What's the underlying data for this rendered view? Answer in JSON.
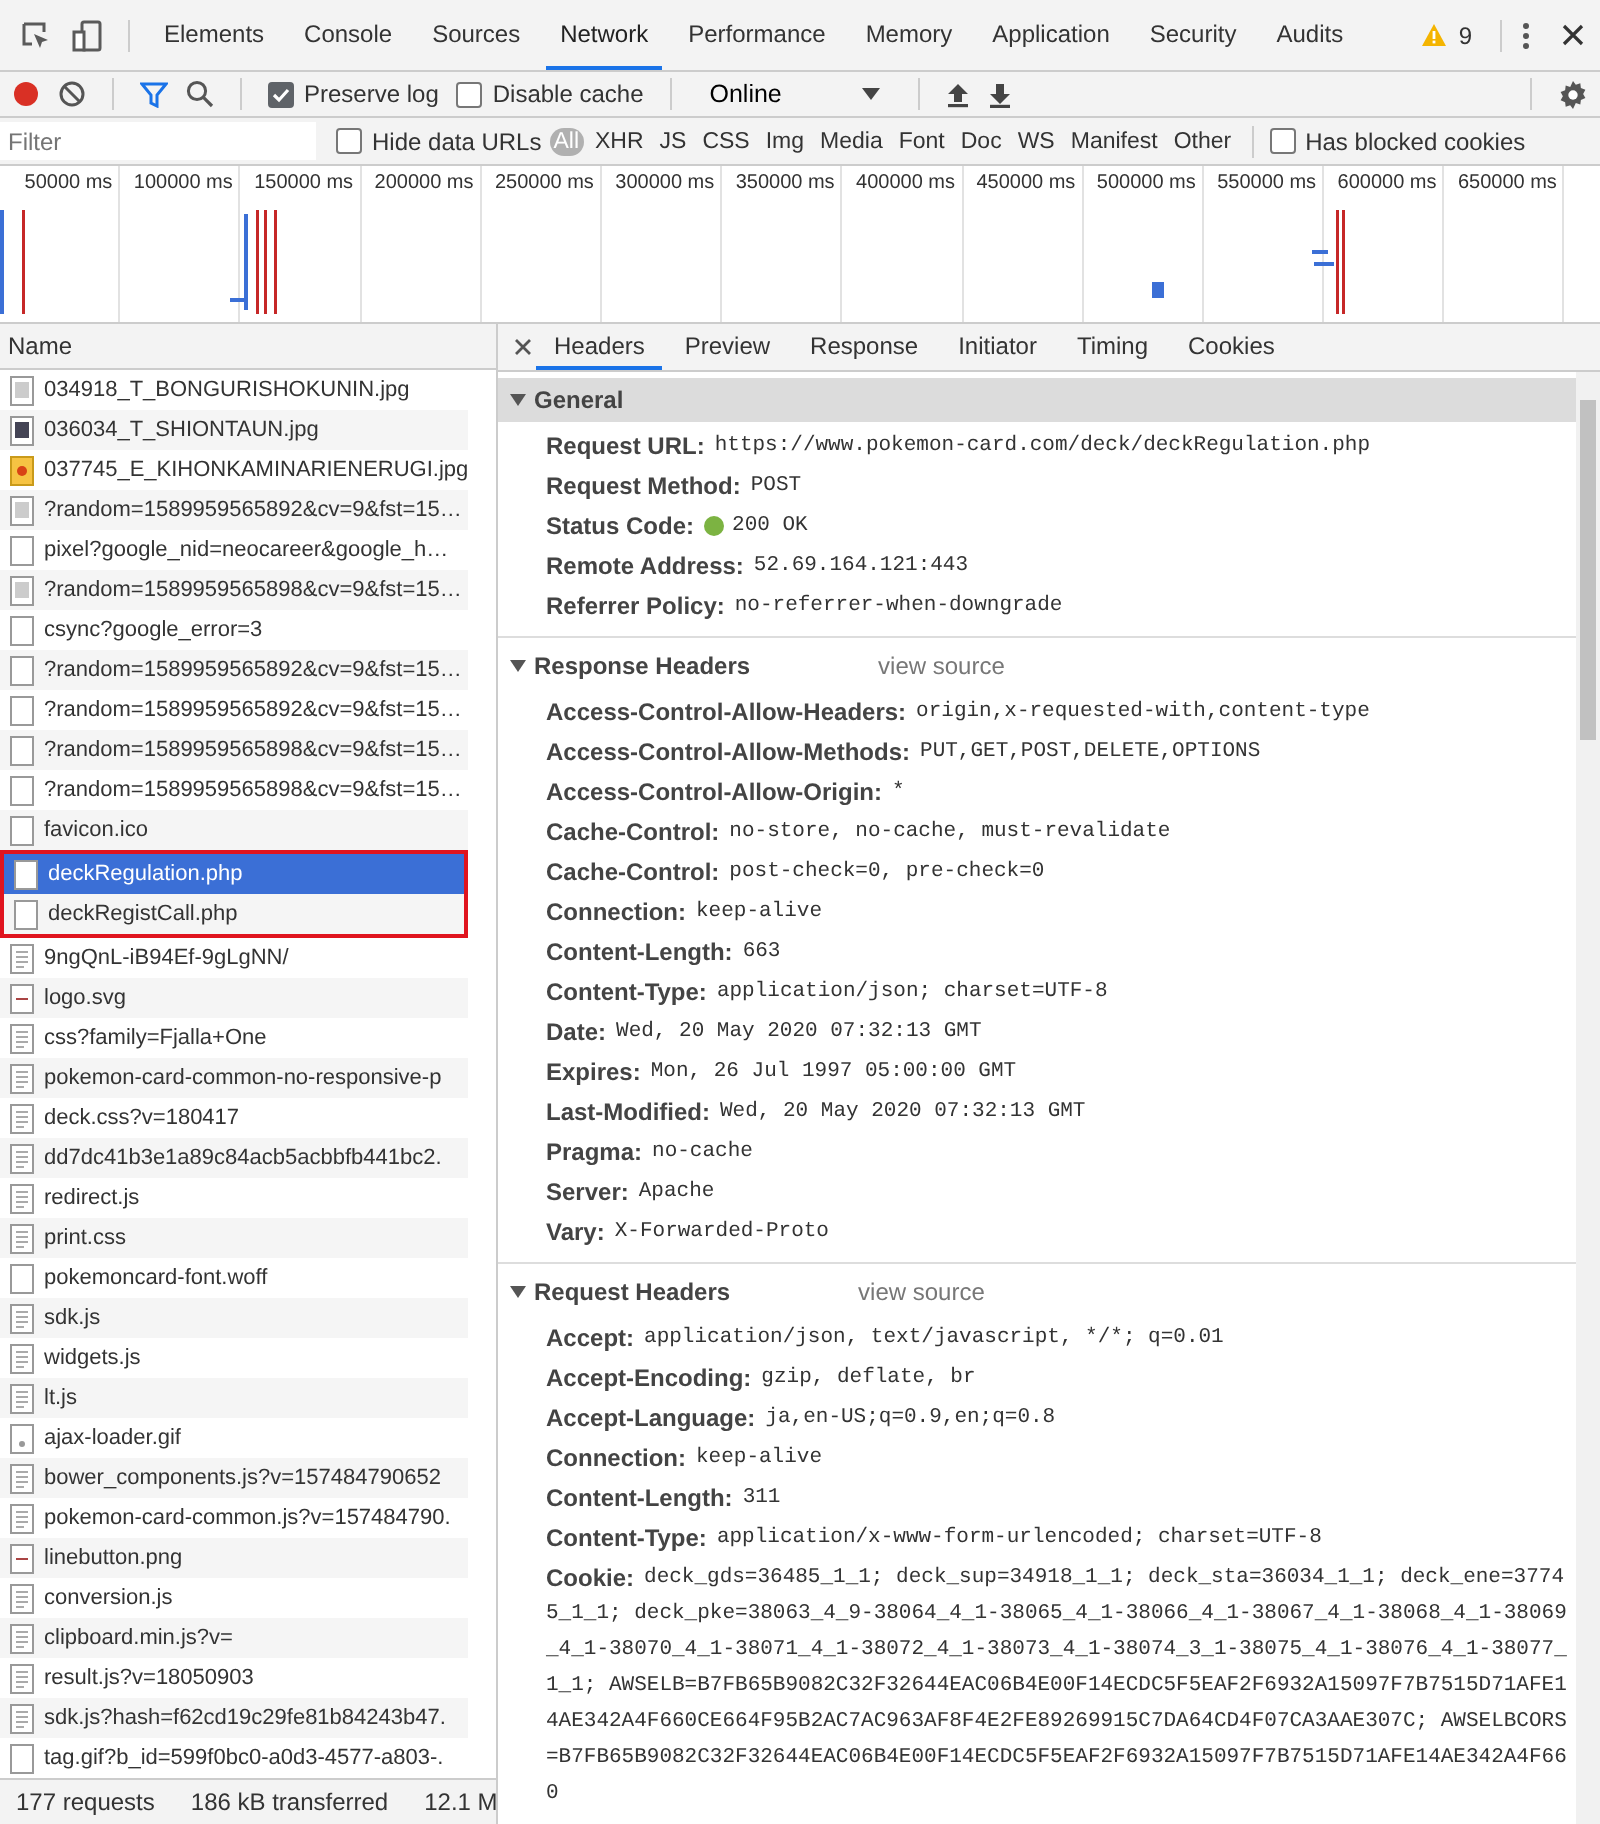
{
  "main_tabs": [
    {
      "label": "Elements",
      "selected": false
    },
    {
      "label": "Console",
      "selected": false
    },
    {
      "label": "Sources",
      "selected": false
    },
    {
      "label": "Network",
      "selected": true
    },
    {
      "label": "Performance",
      "selected": false
    },
    {
      "label": "Memory",
      "selected": false
    },
    {
      "label": "Application",
      "selected": false
    },
    {
      "label": "Security",
      "selected": false
    },
    {
      "label": "Audits",
      "selected": false
    }
  ],
  "warnings": "9",
  "toolbar": {
    "recording": true,
    "preserve_log": {
      "label": "Preserve log",
      "checked": true
    },
    "disable_cache": {
      "label": "Disable cache",
      "checked": false
    },
    "throttling": "Online"
  },
  "filter_bar": {
    "placeholder": "Filter",
    "hide_data_urls": {
      "label": "Hide data URLs",
      "checked": false
    },
    "types": [
      {
        "label": "All",
        "selected": true
      },
      {
        "label": "XHR",
        "selected": false
      },
      {
        "label": "JS",
        "selected": false
      },
      {
        "label": "CSS",
        "selected": false
      },
      {
        "label": "Img",
        "selected": false
      },
      {
        "label": "Media",
        "selected": false
      },
      {
        "label": "Font",
        "selected": false
      },
      {
        "label": "Doc",
        "selected": false
      },
      {
        "label": "WS",
        "selected": false
      },
      {
        "label": "Manifest",
        "selected": false
      },
      {
        "label": "Other",
        "selected": false
      }
    ],
    "blocked_cookies": {
      "label": "Has blocked cookies",
      "checked": false
    }
  },
  "timeline": {
    "ticks": [
      "50000 ms",
      "100000 ms",
      "150000 ms",
      "200000 ms",
      "250000 ms",
      "300000 ms",
      "350000 ms",
      "400000 ms",
      "450000 ms",
      "500000 ms",
      "550000 ms",
      "600000 ms",
      "650000 ms"
    ]
  },
  "requests": {
    "column": "Name",
    "rows": [
      {
        "name": "034918_T_BONGURISHOKUNIN.jpg",
        "kind": "image",
        "selected": false,
        "outlined": false
      },
      {
        "name": "036034_T_SHIONTAUN.jpg",
        "kind": "photo",
        "selected": false,
        "outlined": false
      },
      {
        "name": "037745_E_KIHONKAMINARIENERUGI.jpg",
        "kind": "card",
        "selected": false,
        "outlined": false
      },
      {
        "name": "?random=1589959565892&cv=9&fst=15…",
        "kind": "image",
        "selected": false,
        "outlined": false
      },
      {
        "name": "pixel?google_nid=neocareer&google_h…",
        "kind": "blank",
        "selected": false,
        "outlined": false
      },
      {
        "name": "?random=1589959565898&cv=9&fst=15…",
        "kind": "image",
        "selected": false,
        "outlined": false
      },
      {
        "name": "csync?google_error=3",
        "kind": "blank",
        "selected": false,
        "outlined": false
      },
      {
        "name": "?random=1589959565892&cv=9&fst=15…",
        "kind": "blank",
        "selected": false,
        "outlined": false
      },
      {
        "name": "?random=1589959565892&cv=9&fst=15…",
        "kind": "blank",
        "selected": false,
        "outlined": false
      },
      {
        "name": "?random=1589959565898&cv=9&fst=15…",
        "kind": "blank",
        "selected": false,
        "outlined": false
      },
      {
        "name": "?random=1589959565898&cv=9&fst=15…",
        "kind": "blank",
        "selected": false,
        "outlined": false
      },
      {
        "name": "favicon.ico",
        "kind": "blank",
        "selected": false,
        "outlined": false
      },
      {
        "name": "deckRegulation.php",
        "kind": "blank",
        "selected": true,
        "outlined": true
      },
      {
        "name": "deckRegistCall.php",
        "kind": "blank",
        "selected": false,
        "outlined": true
      },
      {
        "name": "9ngQnL-iB94Ef-9gLgNN/",
        "kind": "script",
        "selected": false,
        "outlined": false
      },
      {
        "name": "logo.svg",
        "kind": "vector",
        "selected": false,
        "outlined": false
      },
      {
        "name": "css?family=Fjalla+One",
        "kind": "script",
        "selected": false,
        "outlined": false
      },
      {
        "name": "pokemon-card-common-no-responsive-p",
        "kind": "script",
        "selected": false,
        "outlined": false
      },
      {
        "name": "deck.css?v=180417",
        "kind": "script",
        "selected": false,
        "outlined": false
      },
      {
        "name": "dd7dc41b3e1a89c84acb5acbbfb441bc2.",
        "kind": "script",
        "selected": false,
        "outlined": false
      },
      {
        "name": "redirect.js",
        "kind": "script",
        "selected": false,
        "outlined": false
      },
      {
        "name": "print.css",
        "kind": "script",
        "selected": false,
        "outlined": false
      },
      {
        "name": "pokemoncard-font.woff",
        "kind": "blank",
        "selected": false,
        "outlined": false
      },
      {
        "name": "sdk.js",
        "kind": "script",
        "selected": false,
        "outlined": false
      },
      {
        "name": "widgets.js",
        "kind": "script",
        "selected": false,
        "outlined": false
      },
      {
        "name": "lt.js",
        "kind": "script",
        "selected": false,
        "outlined": false
      },
      {
        "name": "ajax-loader.gif",
        "kind": "loader",
        "selected": false,
        "outlined": false
      },
      {
        "name": "bower_components.js?v=157484790652",
        "kind": "script",
        "selected": false,
        "outlined": false
      },
      {
        "name": "pokemon-card-common.js?v=157484790.",
        "kind": "script",
        "selected": false,
        "outlined": false
      },
      {
        "name": "linebutton.png",
        "kind": "vector",
        "selected": false,
        "outlined": false
      },
      {
        "name": "conversion.js",
        "kind": "script",
        "selected": false,
        "outlined": false
      },
      {
        "name": "clipboard.min.js?v=",
        "kind": "script",
        "selected": false,
        "outlined": false
      },
      {
        "name": "result.js?v=18050903",
        "kind": "script",
        "selected": false,
        "outlined": false
      },
      {
        "name": "sdk.js?hash=f62cd19c29fe81b84243b47.",
        "kind": "script",
        "selected": false,
        "outlined": false
      },
      {
        "name": "tag.gif?b_id=599f0bc0-a0d3-4577-a803-.",
        "kind": "blank",
        "selected": false,
        "outlined": false
      }
    ]
  },
  "status_bar": [
    "177 requests",
    "186 kB transferred",
    "12.1 M"
  ],
  "detail_tabs": [
    {
      "label": "Headers",
      "selected": true
    },
    {
      "label": "Preview",
      "selected": false
    },
    {
      "label": "Response",
      "selected": false
    },
    {
      "label": "Initiator",
      "selected": false
    },
    {
      "label": "Timing",
      "selected": false
    },
    {
      "label": "Cookies",
      "selected": false
    }
  ],
  "sections": [
    {
      "title": "General",
      "expanded": true,
      "highlighted": true,
      "rows": [
        {
          "name": "Request URL:",
          "value": "https://www.pokemon-card.com/deck/deckRegulation.php"
        },
        {
          "name": "Request Method:",
          "value": "POST"
        },
        {
          "name": "Status Code:",
          "value": "200 OK",
          "color": "#7cb342"
        },
        {
          "name": "Remote Address:",
          "value": "52.69.164.121:443"
        },
        {
          "name": "Referrer Policy:",
          "value": "no-referrer-when-downgrade"
        }
      ]
    },
    {
      "title": "Response Headers",
      "link": "view source",
      "expanded": true,
      "highlighted": false,
      "rows": [
        {
          "name": "Access-Control-Allow-Headers:",
          "value": "origin,x-requested-with,content-type"
        },
        {
          "name": "Access-Control-Allow-Methods:",
          "value": "PUT,GET,POST,DELETE,OPTIONS"
        },
        {
          "name": "Access-Control-Allow-Origin:",
          "value": "*"
        },
        {
          "name": "Cache-Control:",
          "value": "no-store, no-cache, must-revalidate"
        },
        {
          "name": "Cache-Control:",
          "value": "post-check=0, pre-check=0"
        },
        {
          "name": "Connection:",
          "value": "keep-alive"
        },
        {
          "name": "Content-Length:",
          "value": "663"
        },
        {
          "name": "Content-Type:",
          "value": "application/json; charset=UTF-8"
        },
        {
          "name": "Date:",
          "value": "Wed, 20 May 2020 07:32:13 GMT"
        },
        {
          "name": "Expires:",
          "value": "Mon, 26 Jul 1997 05:00:00 GMT"
        },
        {
          "name": "Last-Modified:",
          "value": "Wed, 20 May 2020 07:32:13 GMT"
        },
        {
          "name": "Pragma:",
          "value": "no-cache"
        },
        {
          "name": "Server:",
          "value": "Apache"
        },
        {
          "name": "Vary:",
          "value": "X-Forwarded-Proto"
        }
      ]
    },
    {
      "title": "Request Headers",
      "link": "view source",
      "expanded": true,
      "highlighted": false,
      "rows": [
        {
          "name": "Accept:",
          "value": "application/json, text/javascript, */*; q=0.01"
        },
        {
          "name": "Accept-Encoding:",
          "value": "gzip, deflate, br"
        },
        {
          "name": "Accept-Language:",
          "value": "ja,en-US;q=0.9,en;q=0.8"
        },
        {
          "name": "Connection:",
          "value": "keep-alive"
        },
        {
          "name": "Content-Length:",
          "value": "311"
        },
        {
          "name": "Content-Type:",
          "value": "application/x-www-form-urlencoded; charset=UTF-8"
        },
        {
          "name": "Cookie:",
          "value": "deck_gds=36485_1_1; deck_sup=34918_1_1; deck_sta=36034_1_1; deck_ene=37745_1_1; deck_pke=38063_4_9-38064_4_1-38065_4_1-38066_4_1-38067_4_1-38068_4_1-38069_4_1-38070_4_1-38071_4_1-38072_4_1-38073_4_1-38074_3_1-38075_4_1-38076_4_1-38077_1_1; AWSELB=B7FB65B9082C32F32644EAC06B4E00F14ECDC5F5EAF2F6932A15097F7B7515D71AFE14AE342A4F660CE664F95B2AC7AC963AF8F4E2FE89269915C7DA64CD4F07CA3AAE307C; AWSELBCORS=B7FB65B9082C32F32644EAC06B4E00F14ECDC5F5EAF2F6932A15097F7B7515D71AFE14AE342A4F660"
        }
      ]
    }
  ]
}
